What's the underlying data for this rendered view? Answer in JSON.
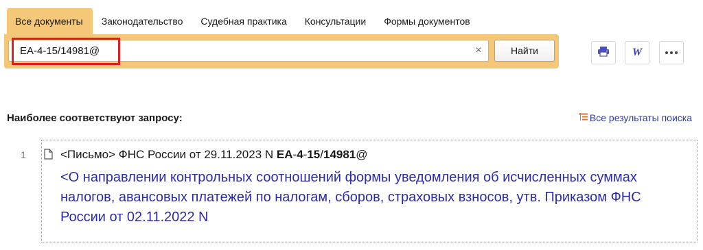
{
  "tabs": [
    {
      "label": "Все документы",
      "active": true
    },
    {
      "label": "Законодательство",
      "active": false
    },
    {
      "label": "Судебная практика",
      "active": false
    },
    {
      "label": "Консультации",
      "active": false
    },
    {
      "label": "Формы документов",
      "active": false
    }
  ],
  "search": {
    "value": "ЕА-4-15/14981@",
    "clear_symbol": "×",
    "button_label": "Найти"
  },
  "actions": {
    "print_icon": "printer-icon",
    "word_icon": "word-export-icon",
    "word_glyph": "W",
    "more_icon": "more-dots-icon"
  },
  "results": {
    "header": "Наиболее соответствуют запросу:",
    "all_results_label": "Все результаты поиска",
    "items": [
      {
        "number": "1",
        "prefix": "<Письмо> ФНС России от 29.11.2023 N ",
        "match_parts": [
          "ЕА",
          "-",
          "4",
          "-",
          "15",
          "/",
          "14981"
        ],
        "suffix": "@",
        "title": "<О направлении контрольных соотношений формы уведомления об исчисленных суммах налогов, авансовых платежей по налогам, сборов, страховых взносов, утв. Приказом ФНС России от 02.11.2022 N"
      }
    ]
  },
  "colors": {
    "accent": "#f4c779",
    "link": "#2c2ca8",
    "highlight": "#e01e1e"
  }
}
